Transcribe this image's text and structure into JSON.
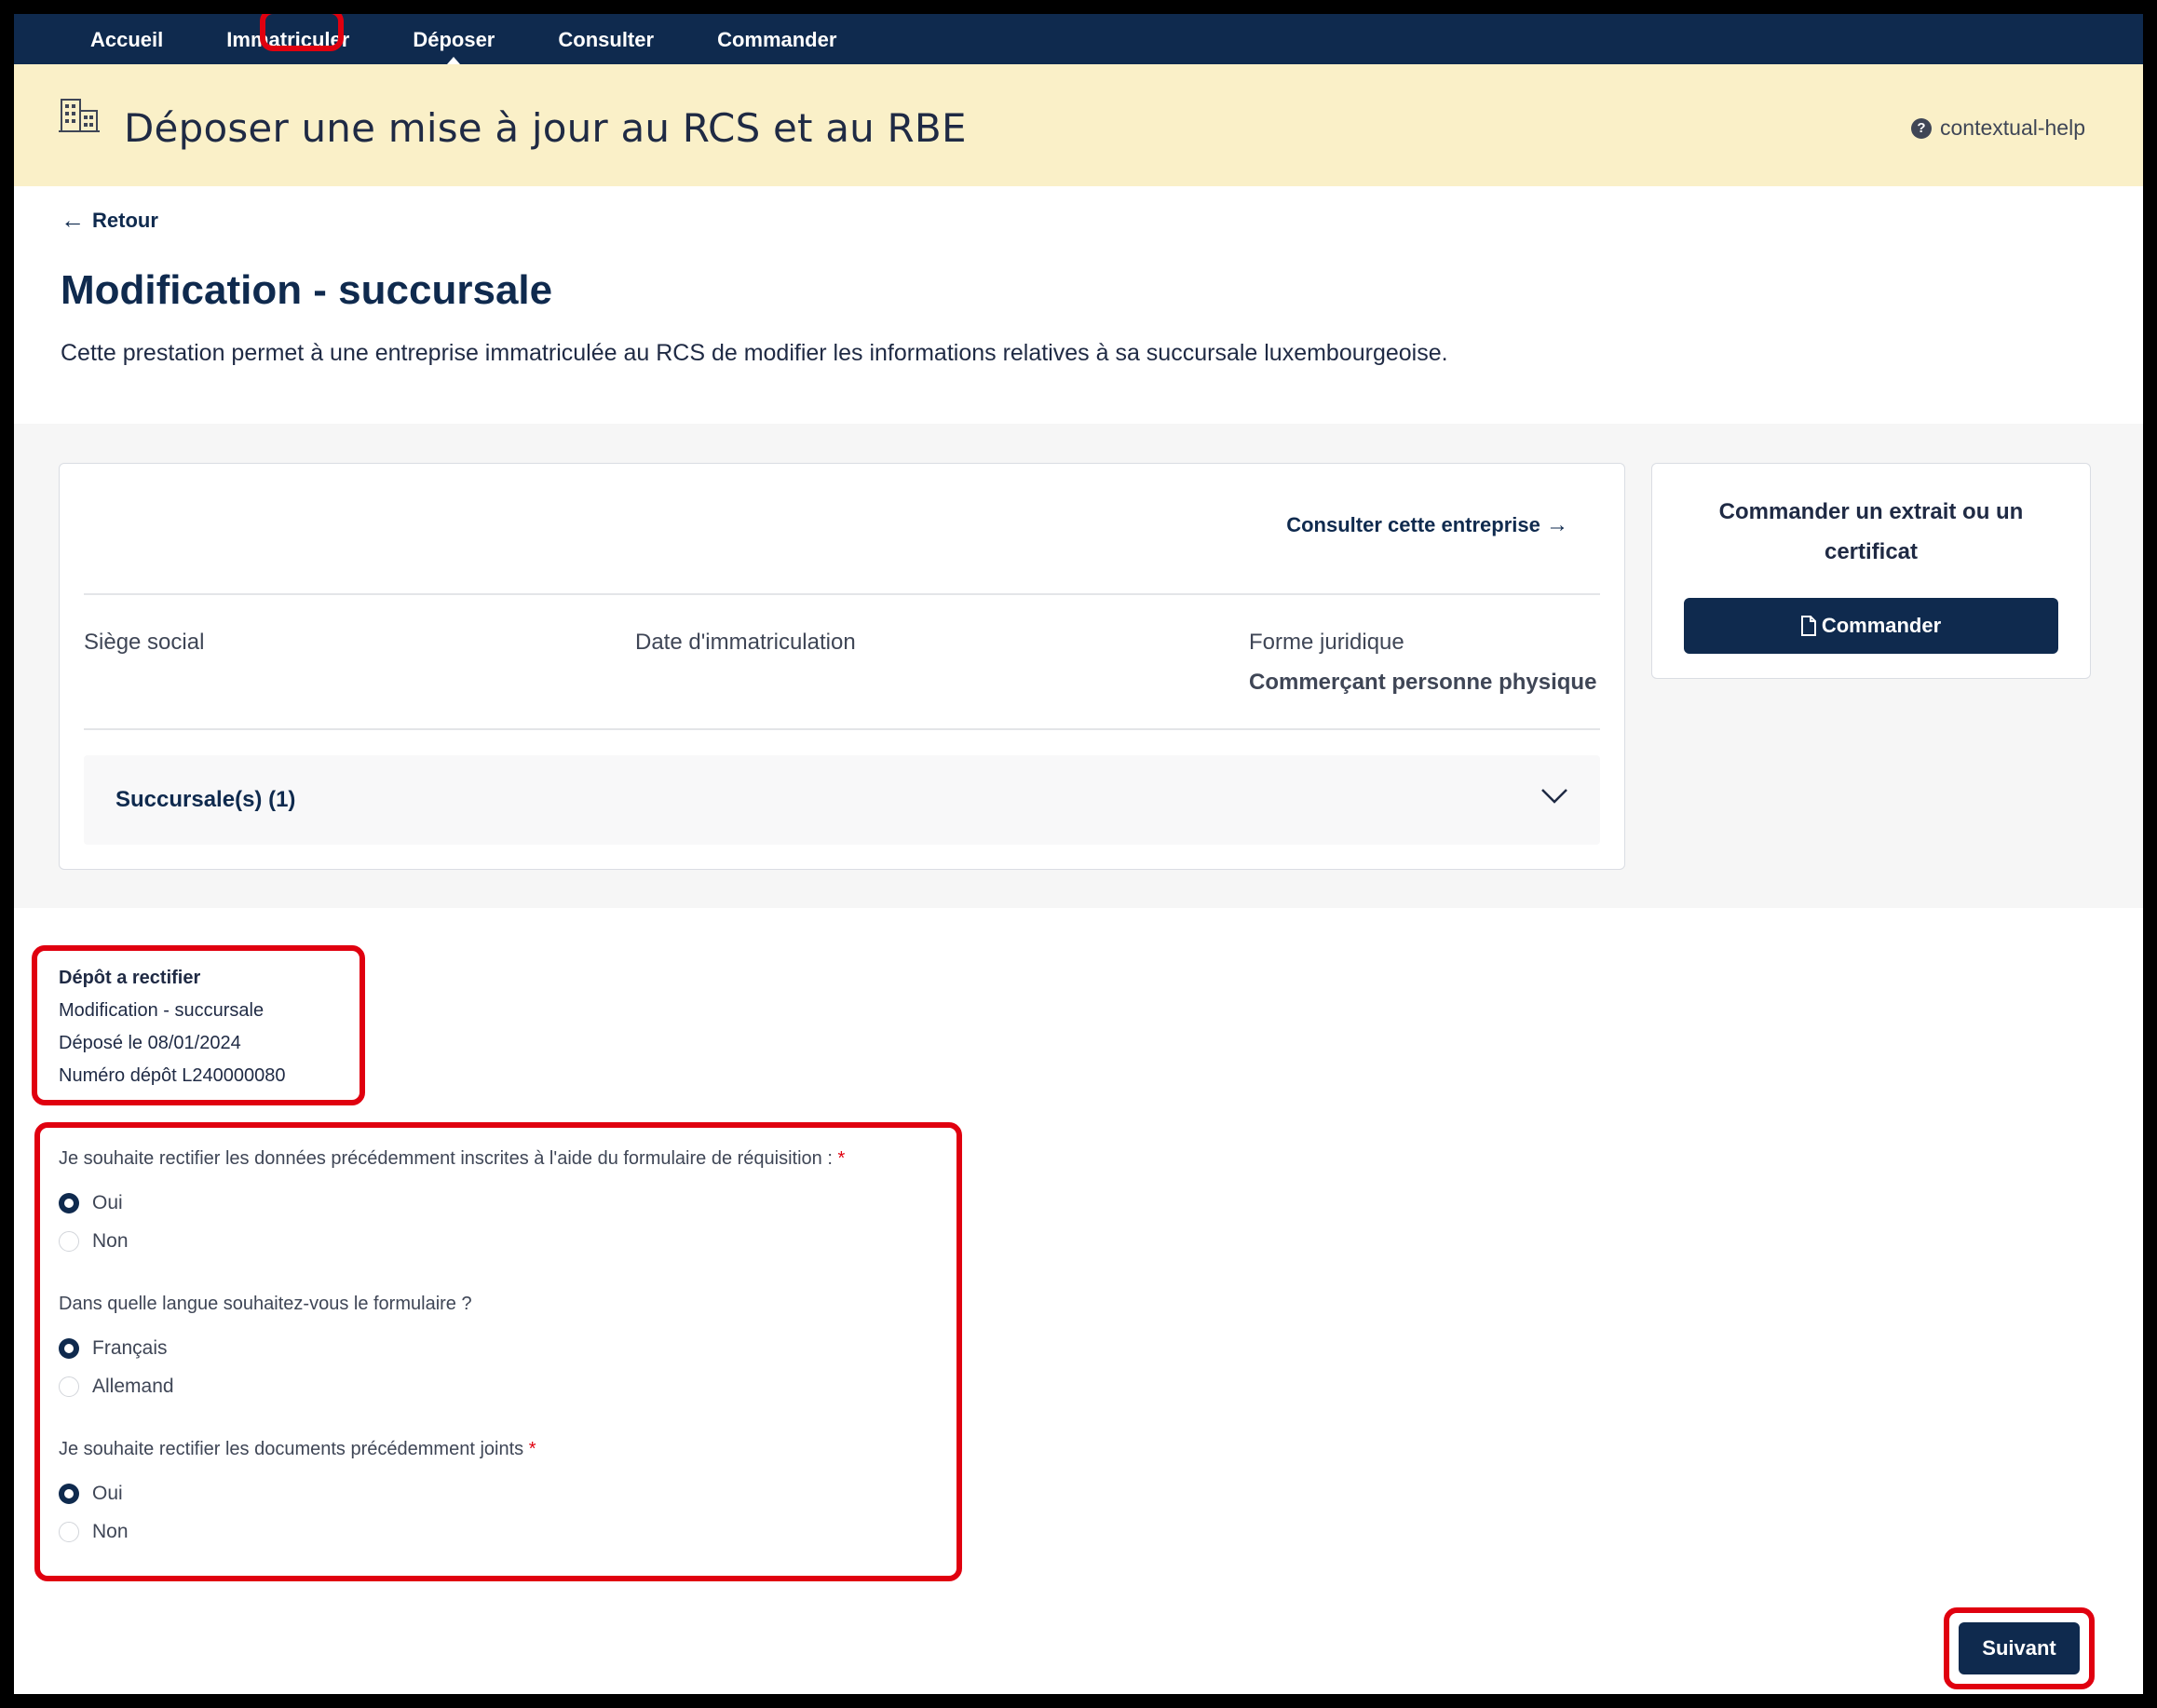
{
  "nav": {
    "items": [
      {
        "label": "Accueil"
      },
      {
        "label": "Immatriculer"
      },
      {
        "label": "Déposer",
        "active": true
      },
      {
        "label": "Consulter"
      },
      {
        "label": "Commander"
      }
    ]
  },
  "banner": {
    "title": "Déposer une mise à jour au RCS et au RBE",
    "help_label": "contextual-help",
    "icon": "building-icon"
  },
  "back_label": "Retour",
  "page": {
    "title": "Modification - succursale",
    "description": "Cette prestation permet à une entreprise immatriculée au RCS de modifier les informations relatives à sa succursale luxembourgeoise."
  },
  "company_card": {
    "consult_link": "Consulter cette entreprise",
    "fields": {
      "seat_label": "Siège social",
      "date_label": "Date d'immatriculation",
      "form_label": "Forme juridique",
      "form_value": "Commerçant personne physique"
    },
    "branches_label": "Succursale(s) (1)"
  },
  "order_card": {
    "title": "Commander un extrait ou un certificat",
    "button_label": "Commander"
  },
  "depot": {
    "heading": "Dépôt a rectifier",
    "type": "Modification - succursale",
    "date": "Déposé le 08/01/2024",
    "number": "Numéro dépôt L240000080"
  },
  "questions": {
    "q1": {
      "label": "Je souhaite rectifier les données précédemment inscrites à l'aide du formulaire de réquisition :",
      "required": "*",
      "options": [
        "Oui",
        "Non"
      ],
      "selected": "Oui"
    },
    "q2": {
      "label": "Dans quelle langue souhaitez-vous le formulaire ?",
      "options": [
        "Français",
        "Allemand"
      ],
      "selected": "Français"
    },
    "q3": {
      "label": "Je souhaite rectifier les documents précédemment joints",
      "required": "*",
      "options": [
        "Oui",
        "Non"
      ],
      "selected": "Oui"
    }
  },
  "next_label": "Suivant",
  "colors": {
    "navy": "#0f2a4e",
    "banner_bg": "#faf0c8",
    "highlight": "#e0000f"
  }
}
